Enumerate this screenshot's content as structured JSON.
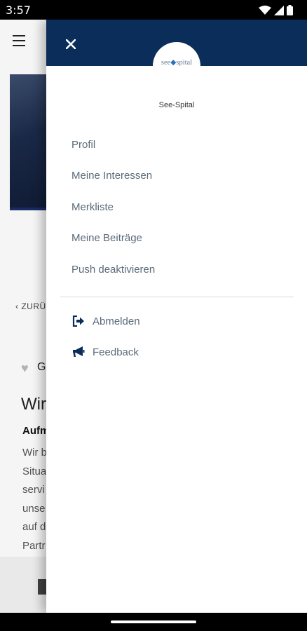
{
  "status_bar": {
    "time": "3:57",
    "icons": [
      "wifi-icon",
      "signal-icon",
      "battery-icon"
    ]
  },
  "background_app": {
    "back_label": "ZURÜ",
    "like_label": "G",
    "article_title": "Wir",
    "article_subtitle": "Aufm",
    "article_lines": [
      "Wir b",
      "Situa",
      "servi",
      "unse",
      "auf d",
      "Partr"
    ]
  },
  "drawer": {
    "header_color": "#0a2d5a",
    "logo": {
      "text_left": "see",
      "text_right": "spital"
    },
    "brand_name": "See-Spital",
    "menu_items": [
      {
        "label": "Profil"
      },
      {
        "label": "Meine Interessen"
      },
      {
        "label": "Merkliste"
      },
      {
        "label": "Meine Beiträge"
      },
      {
        "label": "Push deaktivieren"
      }
    ],
    "actions": [
      {
        "label": "Abmelden",
        "icon": "logout-icon"
      },
      {
        "label": "Feedback",
        "icon": "megaphone-icon"
      }
    ]
  }
}
